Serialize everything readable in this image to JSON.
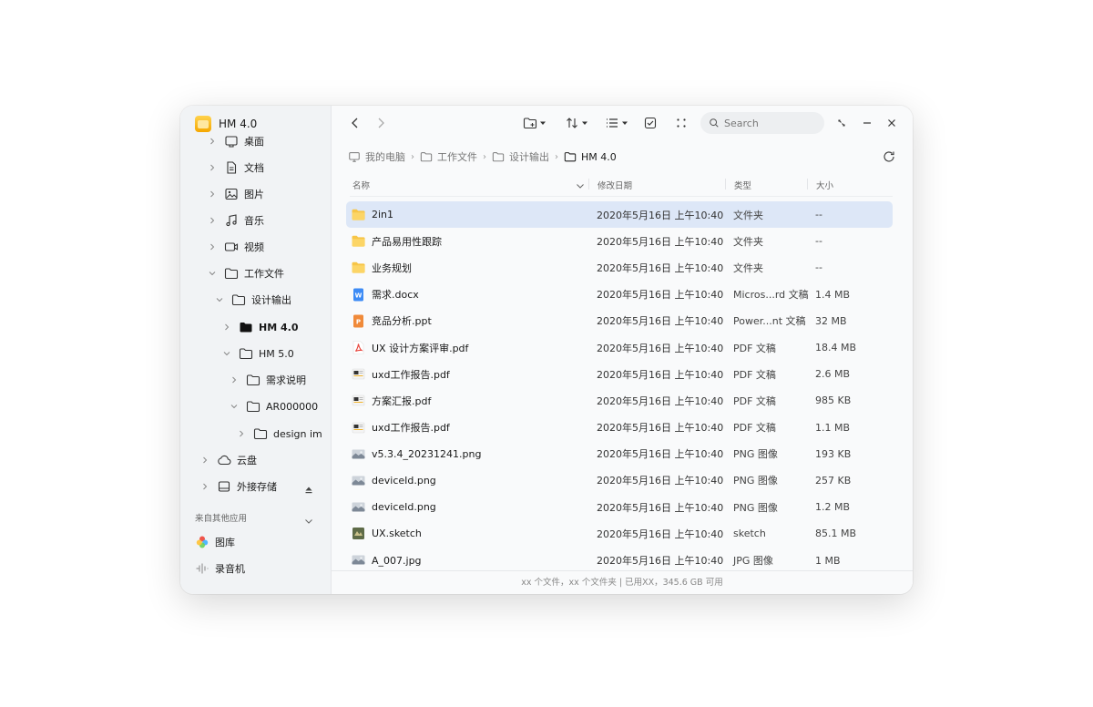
{
  "app": {
    "title": "HM 4.0"
  },
  "sidebar": {
    "tree": [
      {
        "label": "桌面",
        "icon": "desktop-icon",
        "expanded": false
      },
      {
        "label": "文档",
        "icon": "document-icon",
        "expanded": false
      },
      {
        "label": "图片",
        "icon": "image-icon",
        "expanded": false
      },
      {
        "label": "音乐",
        "icon": "music-icon",
        "expanded": false
      },
      {
        "label": "视频",
        "icon": "video-icon",
        "expanded": false
      },
      {
        "label": "工作文件",
        "icon": "folder-icon",
        "expanded": true
      },
      {
        "label": "设计输出",
        "icon": "folder-icon",
        "expanded": true
      },
      {
        "label": "HM 4.0",
        "icon": "folder-filled-icon",
        "expanded": false,
        "active": true
      },
      {
        "label": "HM 5.0",
        "icon": "folder-icon",
        "expanded": true
      },
      {
        "label": "需求说明",
        "icon": "folder-icon",
        "expanded": false
      },
      {
        "label": "AR000000",
        "icon": "folder-icon",
        "expanded": true
      },
      {
        "label": "design im",
        "icon": "folder-icon",
        "expanded": false
      },
      {
        "label": "云盘",
        "icon": "cloud-icon",
        "expanded": false
      },
      {
        "label": "外接存储",
        "icon": "drive-icon",
        "expanded": false
      }
    ],
    "other_apps_label": "来自其他应用",
    "apps": [
      {
        "label": "图库",
        "icon": "gallery-icon"
      },
      {
        "label": "录音机",
        "icon": "recorder-icon"
      }
    ]
  },
  "toolbar": {
    "search_placeholder": "Search"
  },
  "breadcrumb": [
    {
      "label": "我的电脑",
      "icon": "computer-icon"
    },
    {
      "label": "工作文件",
      "icon": "folder-icon"
    },
    {
      "label": "设计输出",
      "icon": "folder-icon"
    },
    {
      "label": "HM 4.0",
      "icon": "folder-filled-icon"
    }
  ],
  "columns": {
    "name": "名称",
    "date": "修改日期",
    "type": "类型",
    "size": "大小"
  },
  "files": [
    {
      "name": "2in1",
      "date": "2020年5月16日  上午10:40",
      "type": "文件夹",
      "size": "--",
      "icon": "folder-icon",
      "selected": true
    },
    {
      "name": "产品易用性跟踪",
      "date": "2020年5月16日  上午10:40",
      "type": "文件夹",
      "size": "--",
      "icon": "folder-icon"
    },
    {
      "name": "业务规划",
      "date": "2020年5月16日  上午10:40",
      "type": "文件夹",
      "size": "--",
      "icon": "folder-icon"
    },
    {
      "name": "需求.docx",
      "date": "2020年5月16日  上午10:40",
      "type": "Micros...rd 文稿",
      "size": "1.4 MB",
      "icon": "word-file-icon"
    },
    {
      "name": "竞品分析.ppt",
      "date": "2020年5月16日  上午10:40",
      "type": "Power...nt 文稿",
      "size": "32 MB",
      "icon": "powerpoint-file-icon"
    },
    {
      "name": "UX 设计方案评审.pdf",
      "date": "2020年5月16日  上午10:40",
      "type": "PDF 文稿",
      "size": "18.4 MB",
      "icon": "pdf-file-icon"
    },
    {
      "name": "uxd工作报告.pdf",
      "date": "2020年5月16日  上午10:40",
      "type": "PDF 文稿",
      "size": "2.6 MB",
      "icon": "pdf-thumbnail-icon"
    },
    {
      "name": "方案汇报.pdf",
      "date": "2020年5月16日  上午10:40",
      "type": "PDF 文稿",
      "size": "985 KB",
      "icon": "pdf-thumbnail-icon"
    },
    {
      "name": "uxd工作报告.pdf",
      "date": "2020年5月16日  上午10:40",
      "type": "PDF 文稿",
      "size": "1.1 MB",
      "icon": "pdf-thumbnail-icon"
    },
    {
      "name": "v5.3.4_20231241.png",
      "date": "2020年5月16日  上午10:40",
      "type": "PNG 图像",
      "size": "193 KB",
      "icon": "image-thumbnail-icon"
    },
    {
      "name": "deviceId.png",
      "date": "2020年5月16日  上午10:40",
      "type": "PNG 图像",
      "size": "257 KB",
      "icon": "image-thumbnail-icon"
    },
    {
      "name": "deviceId.png",
      "date": "2020年5月16日  上午10:40",
      "type": "PNG 图像",
      "size": "1.2 MB",
      "icon": "image-thumbnail-icon"
    },
    {
      "name": "UX.sketch",
      "date": "2020年5月16日  上午10:40",
      "type": "sketch",
      "size": "85.1 MB",
      "icon": "sketch-file-icon"
    },
    {
      "name": "A_007.jpg",
      "date": "2020年5月16日  上午10:40",
      "type": "JPG 图像",
      "size": "1 MB",
      "icon": "image-thumbnail-icon"
    }
  ],
  "status_bar": "xx 个文件，xx 个文件夹 | 已用XX，345.6 GB 可用",
  "colors": {
    "selected_row": "#dde7f7",
    "folder": "#f7c547",
    "sidebar_bg": "#f1f3f5"
  }
}
